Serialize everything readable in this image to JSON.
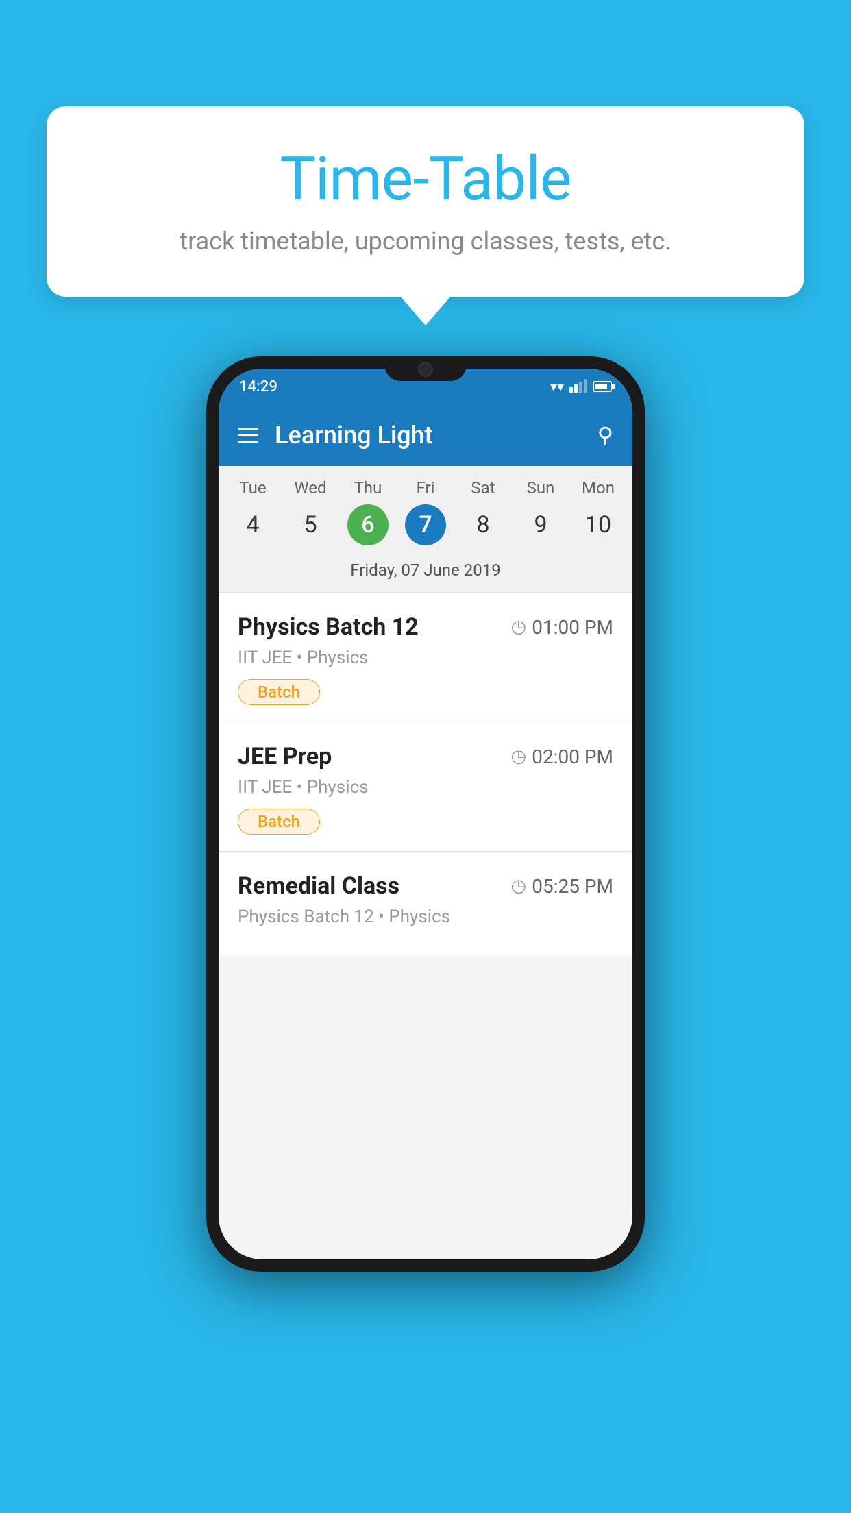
{
  "background_color": "#29b6e8",
  "speech_bubble": {
    "title": "Time-Table",
    "subtitle": "track timetable, upcoming classes, tests, etc."
  },
  "status_bar": {
    "time": "14:29"
  },
  "toolbar": {
    "app_name": "Learning Light",
    "hamburger_label": "menu",
    "search_label": "search"
  },
  "calendar": {
    "days": [
      {
        "label": "Tue",
        "num": "4"
      },
      {
        "label": "Wed",
        "num": "5"
      },
      {
        "label": "Thu",
        "num": "6",
        "state": "today"
      },
      {
        "label": "Fri",
        "num": "7",
        "state": "selected"
      },
      {
        "label": "Sat",
        "num": "8"
      },
      {
        "label": "Sun",
        "num": "9"
      },
      {
        "label": "Mon",
        "num": "10"
      }
    ],
    "selected_date_label": "Friday, 07 June 2019"
  },
  "classes": [
    {
      "name": "Physics Batch 12",
      "time": "01:00 PM",
      "subject_line": "IIT JEE • Physics",
      "badge": "Batch"
    },
    {
      "name": "JEE Prep",
      "time": "02:00 PM",
      "subject_line": "IIT JEE • Physics",
      "badge": "Batch"
    },
    {
      "name": "Remedial Class",
      "time": "05:25 PM",
      "subject_line": "Physics Batch 12 • Physics",
      "badge": null
    }
  ],
  "badge_label": "Batch"
}
